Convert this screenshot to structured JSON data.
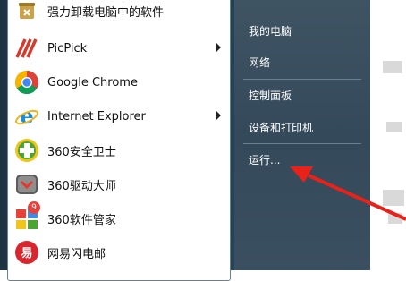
{
  "start_menu": {
    "programs": [
      {
        "label": "强力卸载电脑中的软件",
        "icon": "uninstall-icon",
        "has_submenu": false
      },
      {
        "label": "PicPick",
        "icon": "picpick-icon",
        "has_submenu": true
      },
      {
        "label": "Google Chrome",
        "icon": "chrome-icon",
        "has_submenu": false
      },
      {
        "label": "Internet Explorer",
        "icon": "ie-icon",
        "has_submenu": true
      },
      {
        "label": "360安全卫士",
        "icon": "360-safe-icon",
        "has_submenu": false
      },
      {
        "label": "360驱动大师",
        "icon": "360-driver-icon",
        "has_submenu": false
      },
      {
        "label": "360软件管家",
        "icon": "360-software-icon",
        "has_submenu": false
      },
      {
        "label": "网易闪电邮",
        "icon": "netease-mail-icon",
        "has_submenu": false
      }
    ],
    "badge": "9",
    "right_links": [
      "我的电脑",
      "网络",
      "控制面板",
      "设备和打印机",
      "运行..."
    ]
  },
  "annotation": {
    "color": "#e8221b",
    "target": "运行..."
  }
}
